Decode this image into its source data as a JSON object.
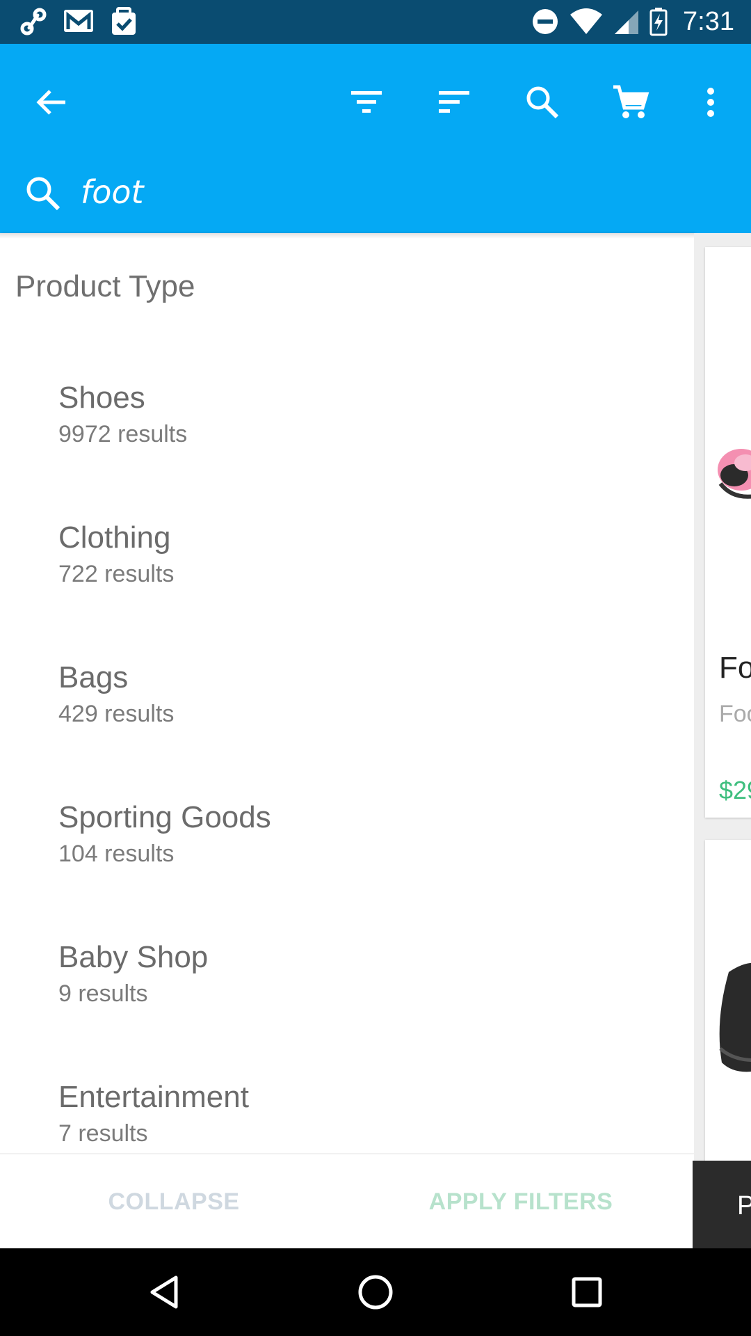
{
  "status_bar": {
    "time": "7:31",
    "left_icons": [
      "link-icon",
      "gmail-icon",
      "calendar-check-icon"
    ],
    "right_icons": [
      "do-not-disturb-icon",
      "wifi-icon",
      "cell-signal-icon",
      "battery-charging-icon"
    ]
  },
  "app_bar": {
    "color": "#05a9f4",
    "actions": [
      "back-arrow-icon",
      "filter-icon",
      "sort-icon",
      "search-icon",
      "cart-icon",
      "more-vert-icon"
    ],
    "search_query": "foot"
  },
  "filter_panel": {
    "section_title": "Product Type",
    "items": [
      {
        "name": "Shoes",
        "count": "9972 results"
      },
      {
        "name": "Clothing",
        "count": "722 results"
      },
      {
        "name": "Bags",
        "count": "429 results"
      },
      {
        "name": "Sporting Goods",
        "count": "104 results"
      },
      {
        "name": "Baby Shop",
        "count": "9 results"
      },
      {
        "name": "Entertainment",
        "count": "7 results"
      }
    ],
    "collapse_label": "COLLAPSE",
    "apply_label": "APPLY FILTERS"
  },
  "results": {
    "card1": {
      "title": "Fo",
      "subtitle": "Foo",
      "price": "$29"
    },
    "price_color": "#3fbf7f",
    "side_tab_label": "P"
  },
  "nav_bar": {
    "buttons": [
      "back-triangle-icon",
      "home-circle-icon",
      "recents-square-icon"
    ]
  }
}
